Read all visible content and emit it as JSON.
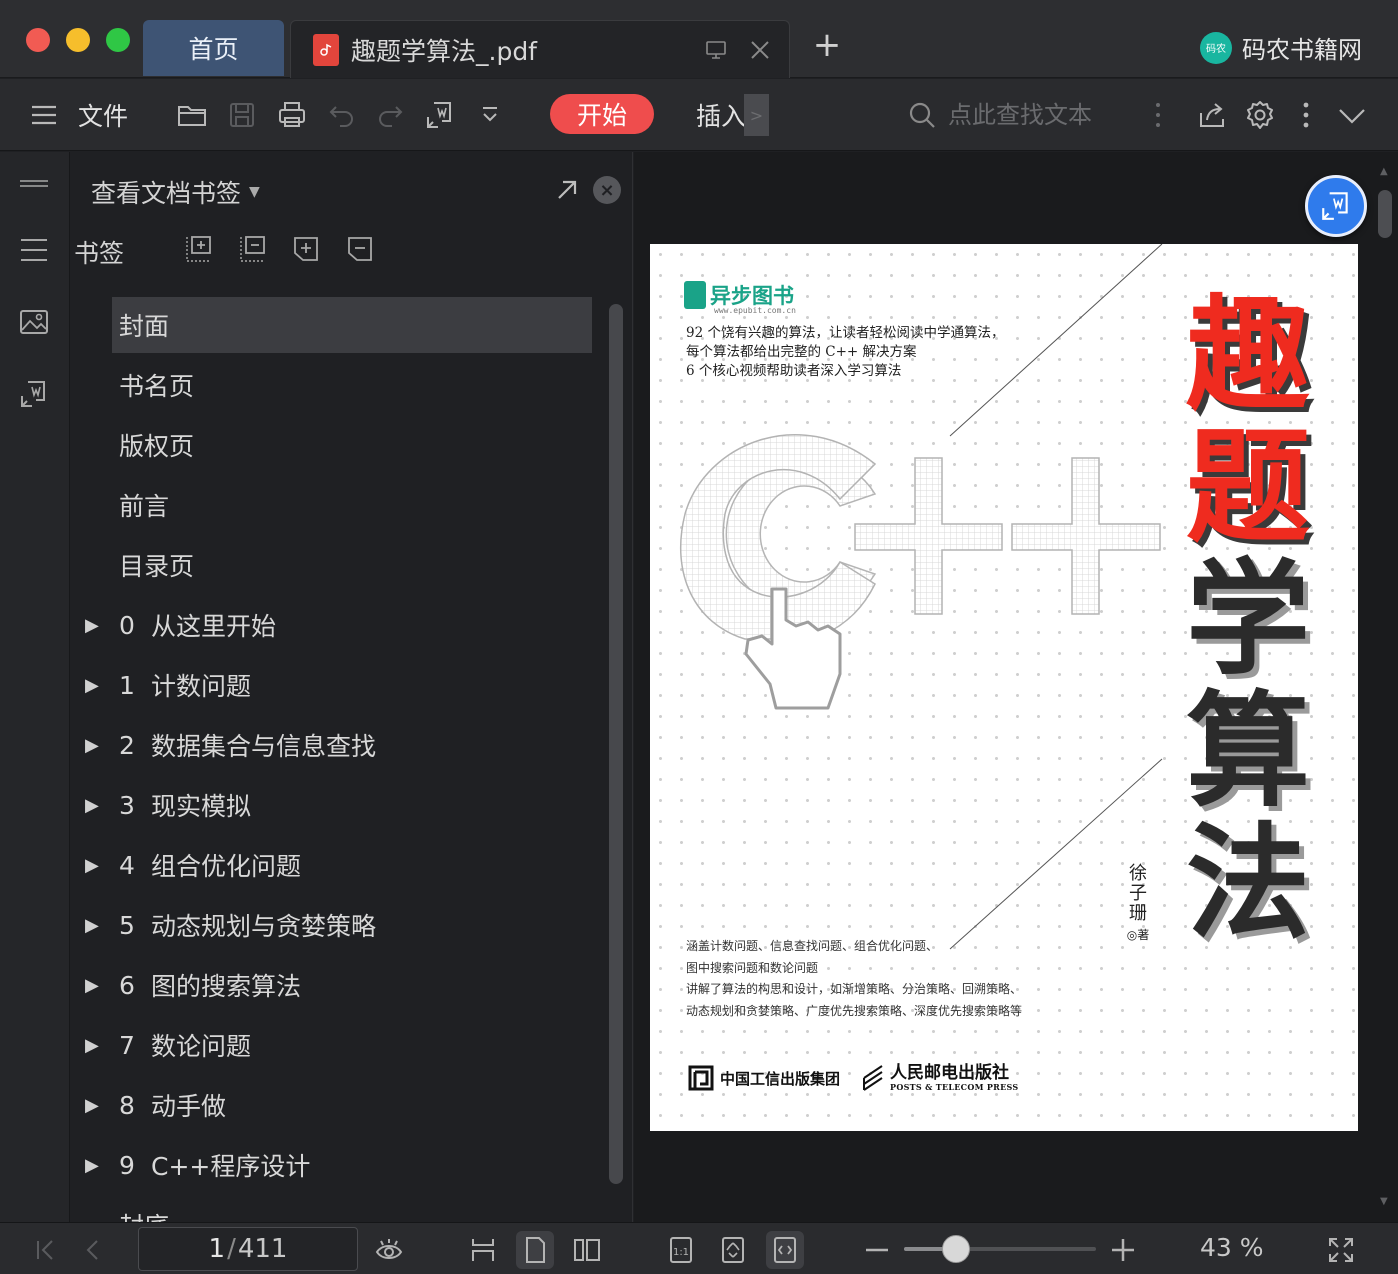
{
  "tabs": {
    "home_label": "首页",
    "doc_label": "趣题学算法_.pdf",
    "add": "+"
  },
  "brand": {
    "name": "码农书籍网",
    "logo_text": "码农"
  },
  "toolbar": {
    "file_label": "文件",
    "start_label": "开始",
    "insert_label": "插入",
    "search_placeholder": "点此查找文本"
  },
  "panel": {
    "header": "查看文档书签",
    "bookmarks_label": "书签",
    "items": [
      {
        "label": "封面",
        "num": "",
        "expandable": false,
        "selected": true
      },
      {
        "label": "书名页",
        "num": "",
        "expandable": false
      },
      {
        "label": "版权页",
        "num": "",
        "expandable": false
      },
      {
        "label": "前言",
        "num": "",
        "expandable": false
      },
      {
        "label": "目录页",
        "num": "",
        "expandable": false
      },
      {
        "label": "从这里开始",
        "num": "0",
        "expandable": true
      },
      {
        "label": "计数问题",
        "num": "1",
        "expandable": true
      },
      {
        "label": "数据集合与信息查找",
        "num": "2",
        "expandable": true
      },
      {
        "label": "现实模拟",
        "num": "3",
        "expandable": true
      },
      {
        "label": "组合优化问题",
        "num": "4",
        "expandable": true
      },
      {
        "label": "动态规划与贪婪策略",
        "num": "5",
        "expandable": true
      },
      {
        "label": "图的搜索算法",
        "num": "6",
        "expandable": true
      },
      {
        "label": "数论问题",
        "num": "7",
        "expandable": true
      },
      {
        "label": "动手做",
        "num": "8",
        "expandable": true
      },
      {
        "label": "C++程序设计",
        "num": "9",
        "expandable": true
      },
      {
        "label": "封底",
        "num": "",
        "expandable": false
      }
    ]
  },
  "cover": {
    "publisher_name": "异步图书",
    "publisher_url": "www.epubit.com.cn",
    "blurb": [
      "92 个饶有兴趣的算法，让读者轻松阅读中学通算法，",
      "每个算法都给出完整的 C++ 解决方案",
      "6 个核心视频帮助读者深入学习算法"
    ],
    "title_chars": [
      "趣",
      "题",
      "学",
      "算",
      "法"
    ],
    "author": "徐子珊",
    "author_suffix": "◎著",
    "features": [
      "涵盖计数问题、信息查找问题、组合优化问题、",
      "图中搜索问题和数论问题",
      "讲解了算法的构思和设计，如渐增策略、分治策略、回溯策略、",
      "动态规划和贪婪策略、广度优先搜索策略、深度优先搜索策略等"
    ],
    "publisher1": "中国工信出版集团",
    "publisher2": "人民邮电出版社",
    "publisher2_en": "POSTS & TELECOM PRESS",
    "colors": {
      "title_red": "#ef2b1f",
      "title_dark": "#2b2b2b",
      "brand_green": "#1aa388"
    }
  },
  "status": {
    "current_page": "1",
    "total_pages": "411",
    "separator": "/",
    "zoom": "43 %",
    "zoom_fraction": 0.27
  },
  "colors": {
    "accent_red": "#ef4d4d",
    "home_tab": "#3e5474",
    "float_button": "#2f7bec"
  }
}
